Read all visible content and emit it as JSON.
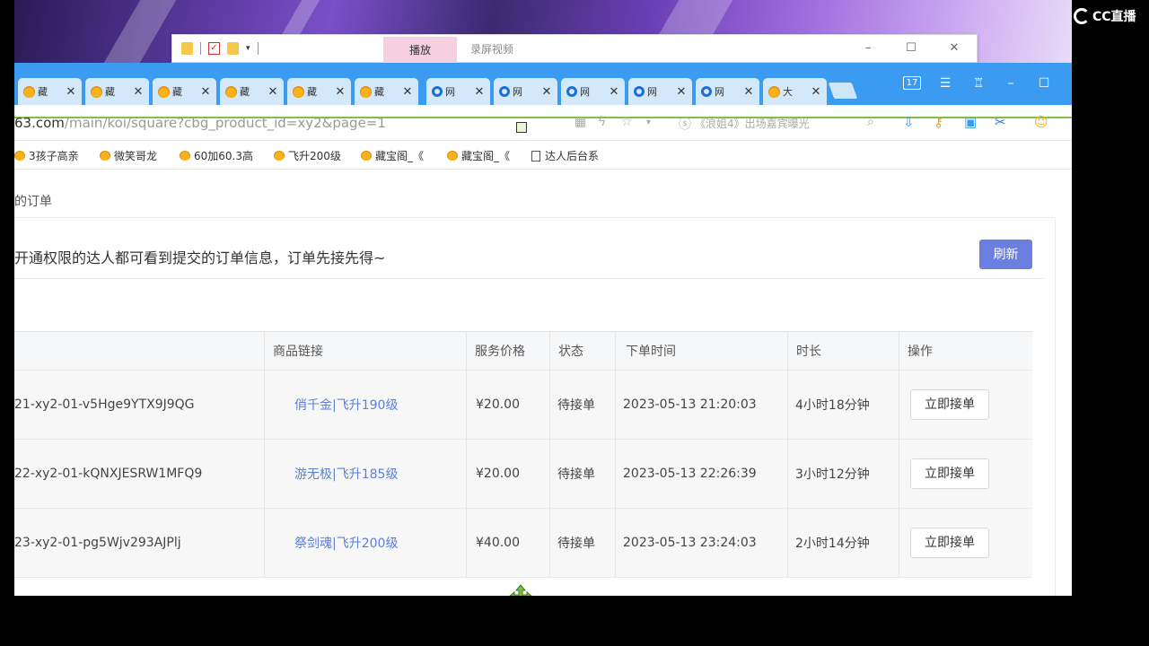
{
  "overlay": {
    "logo_text": "CC直播"
  },
  "popup": {
    "play_label": "播放",
    "rec_label": "录屏视频",
    "minimize": "–",
    "maximize": "☐",
    "close": "✕"
  },
  "tabs": [
    {
      "label": "藏",
      "icon": "chick"
    },
    {
      "label": "藏",
      "icon": "chick"
    },
    {
      "label": "藏",
      "icon": "chick"
    },
    {
      "label": "藏",
      "icon": "chick"
    },
    {
      "label": "藏",
      "icon": "chick"
    },
    {
      "label": "藏",
      "icon": "chick"
    },
    {
      "label": "网",
      "icon": "ie"
    },
    {
      "label": "网",
      "icon": "ie"
    },
    {
      "label": "网",
      "icon": "ie"
    },
    {
      "label": "网",
      "icon": "ie"
    },
    {
      "label": "网",
      "icon": "ie"
    },
    {
      "label": "大",
      "icon": "chick"
    }
  ],
  "tab_close": "✕",
  "chrome_buttons": {
    "calendar": "17",
    "menu": "☰",
    "skin": "♖",
    "minimize": "–",
    "maximize": "☐"
  },
  "address": {
    "domain_part": "63.com",
    "path_part": "/main/koi/square?cbg_product_id=xy2&page=1",
    "search_hint": "《浪姐4》出场嘉宾曝光"
  },
  "bookmarks": [
    {
      "label": "3孩子高亲"
    },
    {
      "label": "微笑哥龙"
    },
    {
      "label": "60加60.3高"
    },
    {
      "label": "飞升200级"
    },
    {
      "label": "藏宝阁_《"
    },
    {
      "label": "藏宝阁_《"
    },
    {
      "label": "达人后台系"
    }
  ],
  "page": {
    "breadcrumb": "的订单",
    "notice": "开通权限的达人都可看到提交的订单信息，订单先接先得~",
    "refresh_label": "刷新"
  },
  "table": {
    "headers": {
      "product_link": "商品链接",
      "price": "服务价格",
      "status": "状态",
      "order_time": "下单时间",
      "duration": "时长",
      "action": "操作"
    },
    "rows": [
      {
        "order_no": "21-xy2-01-v5Hge9YTX9J9QG",
        "product": "俏千金|飞升190级",
        "price": "¥20.00",
        "status": "待接单",
        "time": "2023-05-13 21:20:03",
        "duration": "4小时18分钟",
        "action": "立即接单"
      },
      {
        "order_no": "22-xy2-01-kQNXJESRW1MFQ9",
        "product": "游无极|飞升185级",
        "price": "¥20.00",
        "status": "待接单",
        "time": "2023-05-13 22:26:39",
        "duration": "3小时12分钟",
        "action": "立即接单"
      },
      {
        "order_no": "23-xy2-01-pg5Wjv293AJPlj",
        "product": "祭剑魂|飞升200级",
        "price": "¥40.00",
        "status": "待接单",
        "time": "2023-05-13 23:24:03",
        "duration": "2小时14分钟",
        "action": "立即接单"
      }
    ]
  },
  "colors": {
    "tabbar": "#3a9bf0",
    "refresh_button": "#6a7fe0",
    "link": "#5b7fd8",
    "cursor": "#7bc043"
  }
}
